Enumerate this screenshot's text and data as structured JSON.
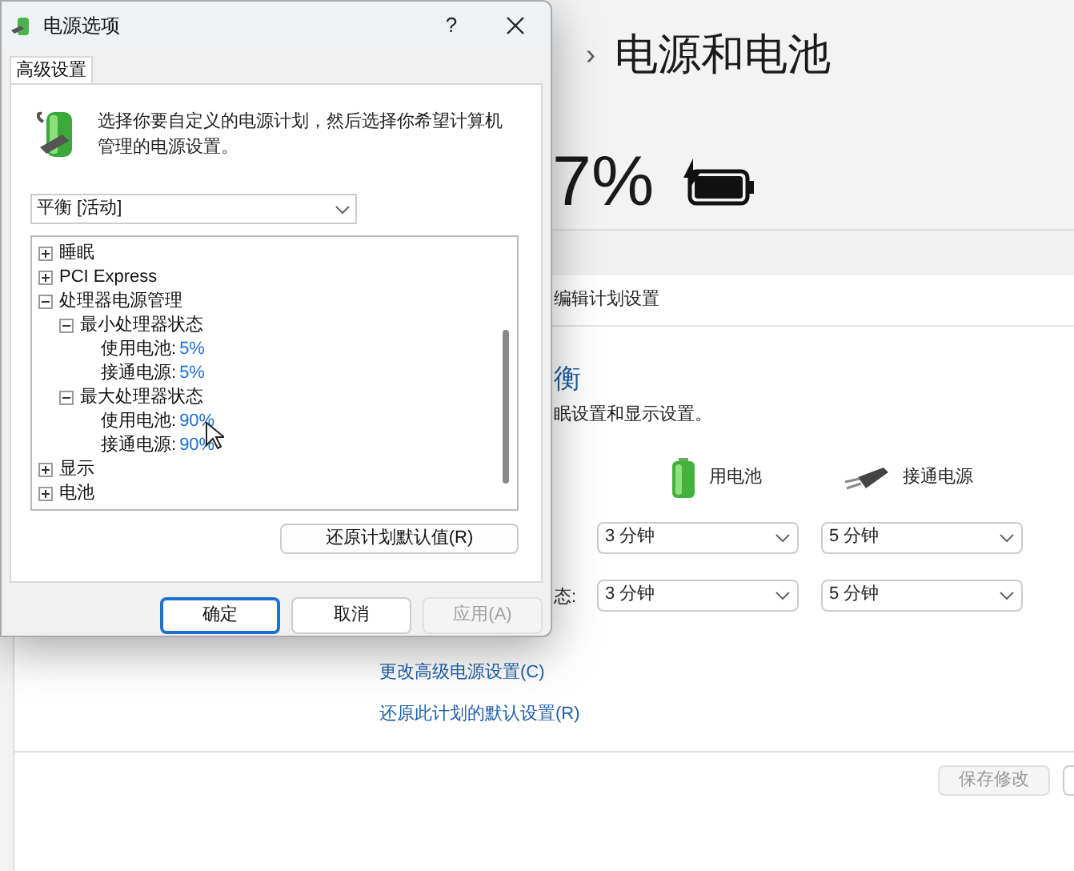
{
  "settings": {
    "breadcrumb_separator": "›",
    "title": "电源和电池",
    "battery_percent": "7%",
    "charging": true
  },
  "plan_window": {
    "address": "编辑计划设置",
    "plan_name": "衡",
    "description": "眠设置和显示设置。",
    "columns": [
      {
        "kind": "battery",
        "label": "用电池"
      },
      {
        "kind": "plugged",
        "label": "接通电源"
      }
    ],
    "rows": [
      {
        "label": "",
        "values": [
          "3 分钟",
          "5 分钟"
        ]
      },
      {
        "label": "态:",
        "values": [
          "3 分钟",
          "5 分钟"
        ]
      }
    ],
    "links": [
      "更改高级电源设置(C)",
      "还原此计划的默认设置(R)"
    ],
    "buttons": [
      {
        "label": "保存修改",
        "disabled": true
      },
      {
        "disabled": false
      }
    ]
  },
  "dialog": {
    "title": "电源选项",
    "help": "?",
    "tab": {
      "label": "高级设置",
      "selected": true
    },
    "intro": "选择你要自定义的电源计划，然后选择你希望计算机管理的电源设置。",
    "plan_select": "平衡 [活动]",
    "tree": [
      {
        "label": "睡眠",
        "expanded": false
      },
      {
        "label": "PCI Express",
        "expanded": false
      },
      {
        "label": "处理器电源管理",
        "expanded": true,
        "children": [
          {
            "label": "最小处理器状态",
            "expanded": true,
            "children": [
              {
                "label": "使用电池:",
                "value": "5%"
              },
              {
                "label": "接通电源:",
                "value": "5%"
              }
            ]
          },
          {
            "label": "最大处理器状态",
            "expanded": true,
            "children": [
              {
                "label": "使用电池:",
                "value": "90%"
              },
              {
                "label": "接通电源:",
                "value": "90%"
              }
            ]
          }
        ]
      },
      {
        "label": "显示",
        "expanded": false
      },
      {
        "label": "电池",
        "expanded": false
      }
    ],
    "restore_button": "还原计划默认值(R)",
    "buttons": [
      {
        "label": "确定",
        "default": true,
        "disabled": false
      },
      {
        "label": "取消",
        "default": false,
        "disabled": false
      },
      {
        "label": "应用(A)",
        "default": false,
        "disabled": true
      }
    ]
  }
}
